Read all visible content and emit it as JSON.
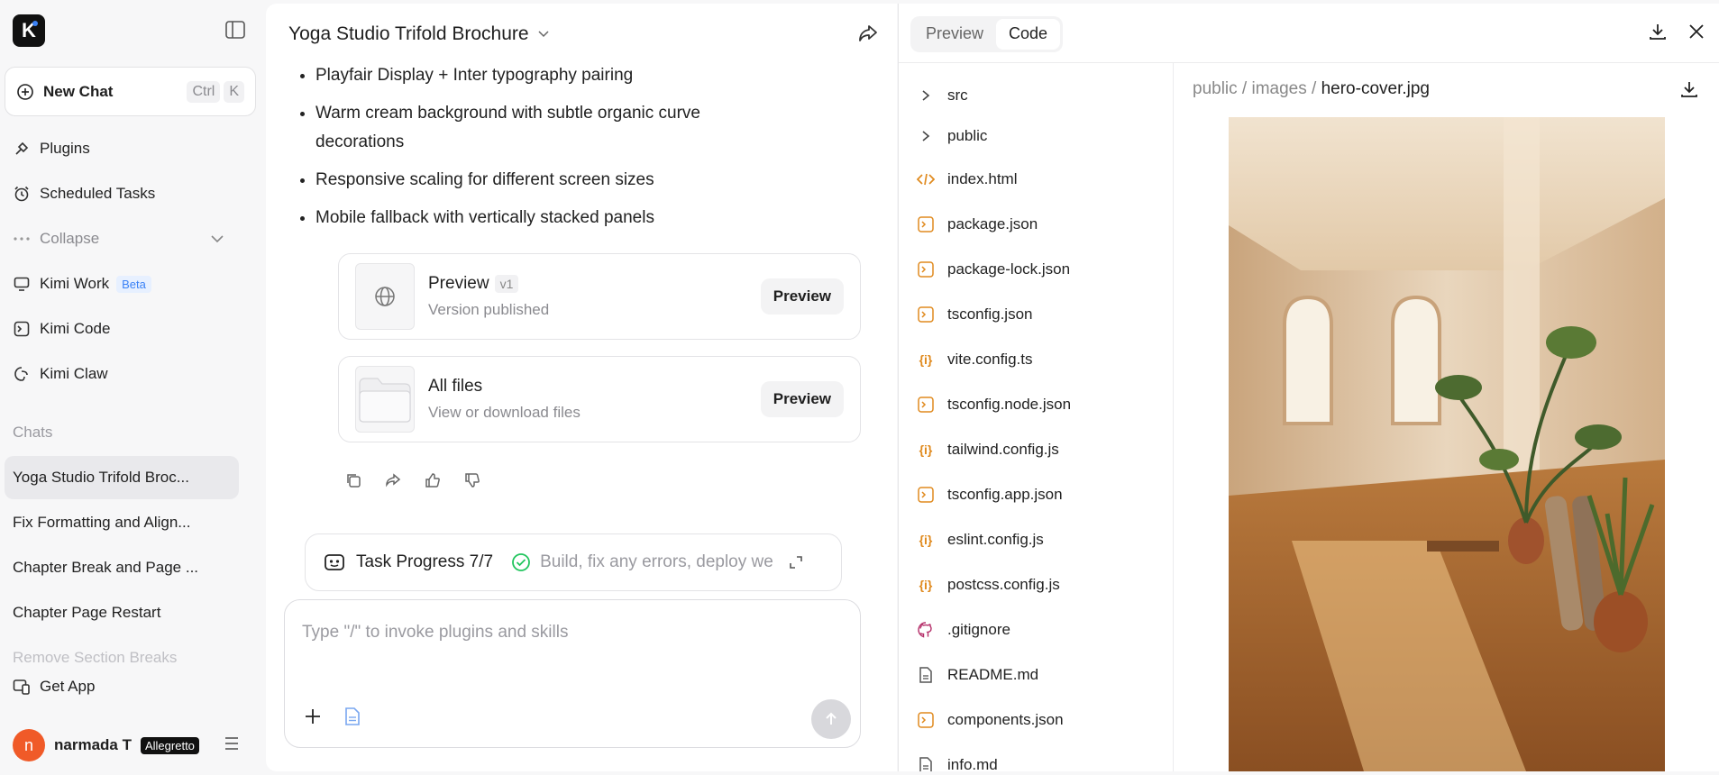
{
  "sidebar": {
    "logo_letter": "K",
    "new_chat": {
      "label": "New Chat",
      "shortcut": [
        "Ctrl",
        "K"
      ]
    },
    "nav": [
      {
        "label": "Plugins",
        "icon": "plug-icon"
      },
      {
        "label": "Scheduled Tasks",
        "icon": "alarm-clock-icon"
      },
      {
        "label": "Collapse",
        "icon": "more-dots-icon"
      },
      {
        "label": "Kimi Work",
        "icon": "monitor-icon",
        "badge": "Beta"
      },
      {
        "label": "Kimi Code",
        "icon": "terminal-icon"
      },
      {
        "label": "Kimi Claw",
        "icon": "claw-icon"
      }
    ],
    "chats_label": "Chats",
    "chats": [
      "Yoga Studio Trifold Broc...",
      "Fix Formatting and Align...",
      "Chapter Break and Page ...",
      "Chapter Page Restart",
      "Remove Section Breaks"
    ],
    "get_app": "Get App",
    "user": {
      "initial": "n",
      "name": "narmada T",
      "plan": "Allegretto"
    }
  },
  "chat": {
    "title": "Yoga Studio Trifold Brochure",
    "bullets": [
      "Playfair Display + Inter typography pairing",
      "Warm cream background with subtle organic curve decorations",
      "Responsive scaling for different screen sizes",
      "Mobile fallback with vertically stacked panels"
    ],
    "cards": [
      {
        "title": "Preview",
        "version": "v1",
        "subtitle": "Version published",
        "button": "Preview"
      },
      {
        "title": "All files",
        "subtitle": "View or download files",
        "button": "Preview"
      }
    ],
    "task": {
      "label": "Task Progress 7/7",
      "detail": "Build, fix any errors, deploy we"
    },
    "composer_placeholder": "Type \"/\" to invoke plugins and skills"
  },
  "right_panel": {
    "tabs": [
      "Preview",
      "Code"
    ],
    "active_tab": "Code",
    "files": [
      {
        "name": "src",
        "type": "folder"
      },
      {
        "name": "public",
        "type": "folder"
      },
      {
        "name": "index.html",
        "type": "html"
      },
      {
        "name": "package.json",
        "type": "json"
      },
      {
        "name": "package-lock.json",
        "type": "json"
      },
      {
        "name": "tsconfig.json",
        "type": "json"
      },
      {
        "name": "vite.config.ts",
        "type": "config"
      },
      {
        "name": "tsconfig.node.json",
        "type": "json"
      },
      {
        "name": "tailwind.config.js",
        "type": "config"
      },
      {
        "name": "tsconfig.app.json",
        "type": "json"
      },
      {
        "name": "eslint.config.js",
        "type": "config"
      },
      {
        "name": "postcss.config.js",
        "type": "config"
      },
      {
        "name": ".gitignore",
        "type": "git"
      },
      {
        "name": "README.md",
        "type": "doc"
      },
      {
        "name": "components.json",
        "type": "json"
      },
      {
        "name": "info.md",
        "type": "doc"
      }
    ],
    "path": {
      "segments": [
        "public",
        "images"
      ],
      "file": "hero-cover.jpg"
    }
  },
  "colors": {
    "accent": "#3b82f6",
    "avatar": "#f05a28",
    "file_icon": "#e08a1e",
    "success": "#22c55e"
  }
}
